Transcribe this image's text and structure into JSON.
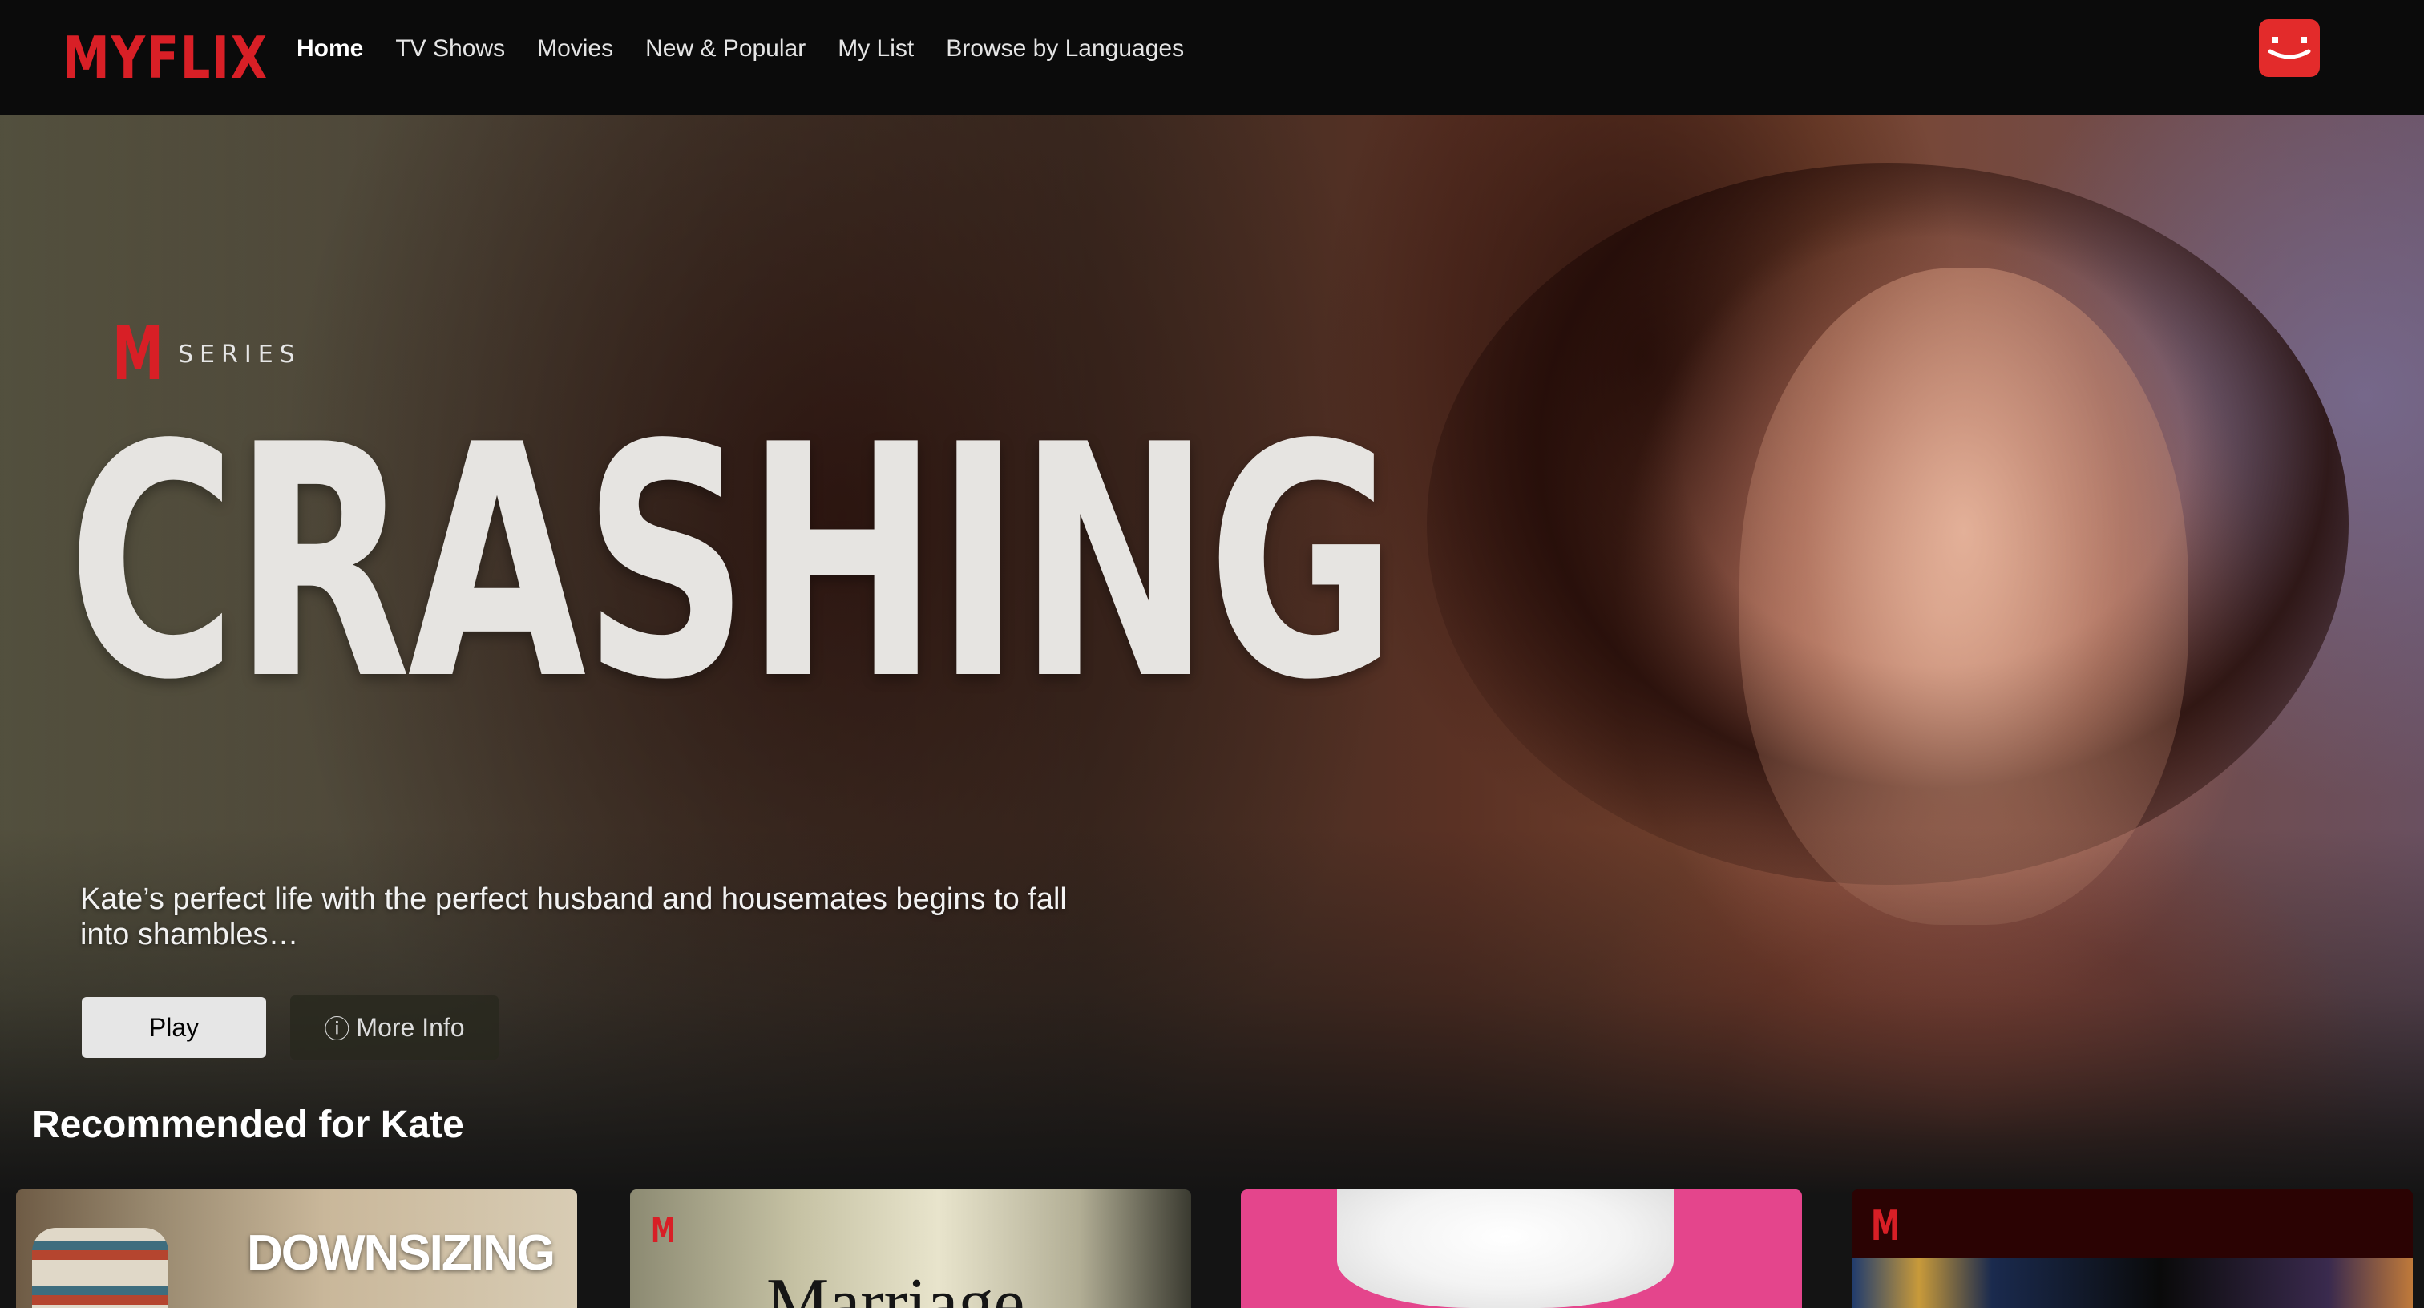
{
  "app": {
    "logo_text": "MYFLIX",
    "brand_color": "#d81f26"
  },
  "nav": {
    "items": [
      {
        "label": "Home",
        "active": true
      },
      {
        "label": "TV Shows"
      },
      {
        "label": "Movies"
      },
      {
        "label": "New & Popular"
      },
      {
        "label": "My List"
      },
      {
        "label": "Browse by Languages"
      }
    ],
    "profile_icon": "smiley-avatar-icon",
    "profile_color": "#e32b2b"
  },
  "hero": {
    "badge_letter": "M",
    "badge_label": "SERIES",
    "title": "CRASHING",
    "description": "Kate’s perfect life with the perfect husband and housemates begins to fall into shambles…",
    "play_label": "Play",
    "info_icon": "ⓘ",
    "more_info_label": "More Info"
  },
  "row": {
    "title": "Recommended for Kate",
    "cards": [
      {
        "title": "DOWNSIZING"
      },
      {
        "badge": "M",
        "title": "Marriage"
      },
      {
        "title": ""
      },
      {
        "badge": "M"
      }
    ]
  }
}
